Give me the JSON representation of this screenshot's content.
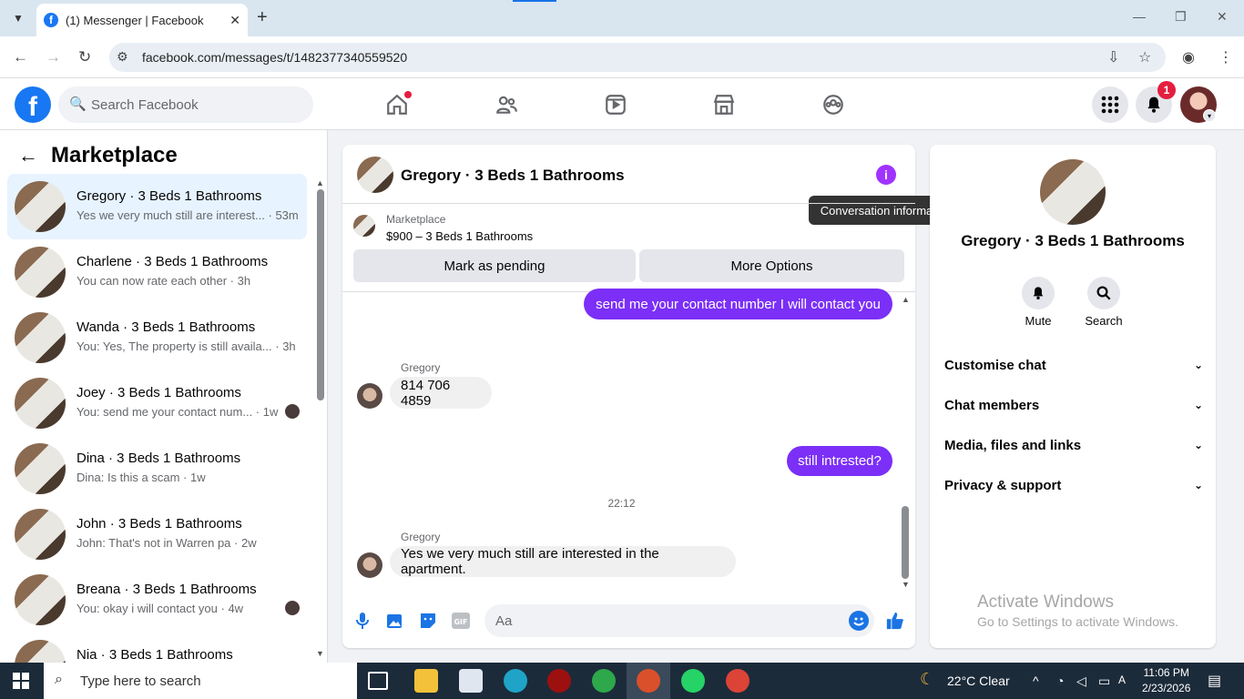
{
  "browser": {
    "tab_title": "(1) Messenger | Facebook",
    "url": "facebook.com/messages/t/1482377340559520"
  },
  "fb": {
    "search_placeholder": "Search Facebook",
    "notification_count": "1"
  },
  "sidebar": {
    "title": "Marketplace",
    "conversations": [
      {
        "name": "Gregory · 3 Beds 1 Bathrooms",
        "preview": "Yes we very much still are interest...",
        "time": "53m"
      },
      {
        "name": "Charlene · 3 Beds 1 Bathrooms",
        "preview": "You can now rate each other",
        "time": "3h"
      },
      {
        "name": "Wanda · 3 Beds 1 Bathrooms",
        "preview": "You: Yes, The property is still availa...",
        "time": "3h"
      },
      {
        "name": "Joey · 3 Beds 1 Bathrooms",
        "preview": "You: send me your contact num...",
        "time": "1w"
      },
      {
        "name": "Dina · 3 Beds 1 Bathrooms",
        "preview": "Dina: Is this a scam",
        "time": "1w"
      },
      {
        "name": "John · 3 Beds 1 Bathrooms",
        "preview": "John: That's not in Warren pa",
        "time": "2w"
      },
      {
        "name": "Breana · 3 Beds 1 Bathrooms",
        "preview": "You: okay i will contact you",
        "time": "4w"
      },
      {
        "name": "Nia · 3 Beds 1 Bathrooms",
        "preview": "",
        "time": ""
      }
    ]
  },
  "chat": {
    "title": "Gregory · 3 Beds 1 Bathrooms",
    "tooltip": "Conversation information",
    "listing_label": "Marketplace",
    "listing_price": "$900 – 3 Beds 1 Bathrooms",
    "mark_pending": "Mark as pending",
    "more_options": "More Options",
    "messages": [
      {
        "from": "me",
        "text": "send me your contact number I will contact you"
      },
      {
        "from": "Gregory",
        "text": "814 706 4859"
      },
      {
        "from": "me",
        "text": "still intrested?"
      },
      {
        "from": "Gregory",
        "text": "Yes we very much still are interested in the apartment."
      }
    ],
    "timestamp": "22:12",
    "composer_placeholder": "Aa"
  },
  "info_panel": {
    "name": "Gregory · 3 Beds 1 Bathrooms",
    "mute_label": "Mute",
    "search_label": "Search",
    "sections": [
      "Customise chat",
      "Chat members",
      "Media, files and links",
      "Privacy & support"
    ]
  },
  "watermark": {
    "line1": "Activate Windows",
    "line2": "Go to Settings to activate Windows."
  },
  "taskbar": {
    "search_placeholder": "Type here to search",
    "weather": "22°C  Clear",
    "time": "11:06 PM",
    "date": "2/23/2026"
  }
}
